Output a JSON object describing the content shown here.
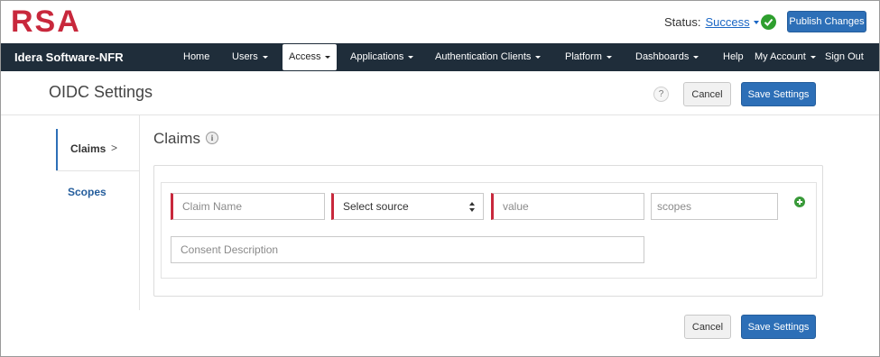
{
  "header": {
    "logo_text": "RSA",
    "status_label": "Status:",
    "status_value": "Success",
    "publish_label": "Publish Changes"
  },
  "navbar": {
    "brand": "Idera Software-NFR",
    "items": [
      {
        "label": "Home"
      },
      {
        "label": "Users"
      },
      {
        "label": "Access"
      },
      {
        "label": "Applications"
      },
      {
        "label": "Authentication Clients"
      },
      {
        "label": "Platform"
      },
      {
        "label": "Dashboards"
      },
      {
        "label": "Help"
      },
      {
        "label": "My Account"
      },
      {
        "label": "Sign Out"
      }
    ],
    "active_item": "Access"
  },
  "page": {
    "title": "OIDC Settings",
    "help_glyph": "?",
    "cancel_label": "Cancel",
    "save_label": "Save Settings"
  },
  "sidebar": {
    "items": [
      {
        "label": "Claims",
        "chevron": ">"
      },
      {
        "label": "Scopes"
      }
    ]
  },
  "claims": {
    "title": "Claims",
    "info_glyph": "i",
    "claim_name_placeholder": "Claim Name",
    "source_selected": "Select source",
    "value_placeholder": "value",
    "scopes_placeholder": "scopes",
    "consent_placeholder": "Consent Description"
  },
  "footer": {
    "cancel_label": "Cancel",
    "save_label": "Save Settings"
  },
  "colors": {
    "navbar_bg": "#1f2d3a",
    "primary": "#2d6fb7",
    "logo_red": "#c8283c",
    "required_marker": "#c8283c",
    "success_green": "#2e9f2e"
  }
}
